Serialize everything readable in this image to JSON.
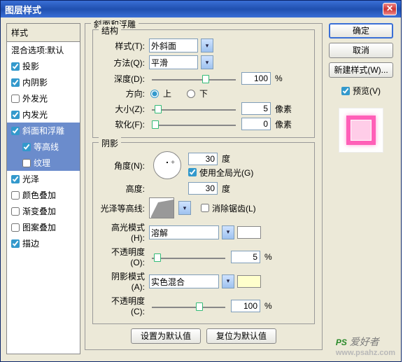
{
  "title": "图层样式",
  "sidebar": {
    "header": "样式",
    "blend_label": "混合选项:默认",
    "items": [
      {
        "label": "投影",
        "checked": true
      },
      {
        "label": "内阴影",
        "checked": true
      },
      {
        "label": "外发光",
        "checked": false
      },
      {
        "label": "内发光",
        "checked": true
      },
      {
        "label": "斜面和浮雕",
        "checked": true,
        "selected": true
      },
      {
        "label": "等高线",
        "checked": true,
        "sub": true,
        "selected": true
      },
      {
        "label": "纹理",
        "checked": false,
        "sub": true,
        "selected": true
      },
      {
        "label": "光泽",
        "checked": true
      },
      {
        "label": "颜色叠加",
        "checked": false
      },
      {
        "label": "渐变叠加",
        "checked": false
      },
      {
        "label": "图案叠加",
        "checked": false
      },
      {
        "label": "描边",
        "checked": true
      }
    ]
  },
  "main": {
    "group_title": "斜面和浮雕",
    "struct": {
      "title": "结构",
      "style_label": "样式(T):",
      "style_value": "外斜面",
      "method_label": "方法(Q):",
      "method_value": "平滑",
      "depth_label": "深度(D):",
      "depth_value": "100",
      "depth_unit": "%",
      "depth_pct": 60,
      "dir_label": "方向:",
      "dir_up": "上",
      "dir_down": "下",
      "dir_sel": "up",
      "size_label": "大小(Z):",
      "size_value": "5",
      "size_unit": "像素",
      "size_pct": 3,
      "soften_label": "软化(F):",
      "soften_value": "0",
      "soften_unit": "像素",
      "soften_pct": 0
    },
    "shadow": {
      "title": "阴影",
      "angle_label": "角度(N):",
      "angle_value": "30",
      "angle_unit": "度",
      "global_label": "使用全局光(G)",
      "global_checked": true,
      "alt_label": "高度:",
      "alt_value": "30",
      "alt_unit": "度",
      "gloss_label": "光泽等高线:",
      "antialias_label": "消除锯齿(L)",
      "antialias_checked": false,
      "hmode_label": "高光模式(H):",
      "hmode_value": "溶解",
      "hopacity_label": "不透明度(O):",
      "hopacity_value": "5",
      "hopacity_unit": "%",
      "hopacity_pct": 3,
      "smode_label": "阴影模式(A):",
      "smode_value": "实色混合",
      "sopacity_label": "不透明度(C):",
      "sopacity_value": "100",
      "sopacity_unit": "%",
      "sopacity_pct": 60
    },
    "defaults": {
      "set": "设置为默认值",
      "reset": "复位为默认值"
    }
  },
  "right": {
    "ok": "确定",
    "cancel": "取消",
    "newstyle": "新建样式(W)...",
    "preview_label": "预览(V)",
    "preview_checked": true
  },
  "watermark": {
    "ps": "PS",
    "txt": " 爱好者",
    "dom": "www.psahz.com"
  }
}
